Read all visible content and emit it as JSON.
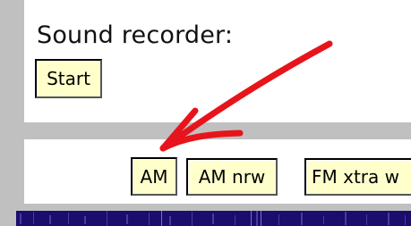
{
  "recorder": {
    "title": "Sound recorder:",
    "start_label": "Start"
  },
  "modes": {
    "am_label": "AM",
    "am_narrow_label": "AM nrw",
    "fm_extra_wide_label": "FM xtra w"
  },
  "colors": {
    "background": "#c0c0c0",
    "panel": "#ffffff",
    "button_face": "#ffffcc",
    "annotation_arrow": "#e8141b",
    "waterfall": "#1a0d6b"
  }
}
